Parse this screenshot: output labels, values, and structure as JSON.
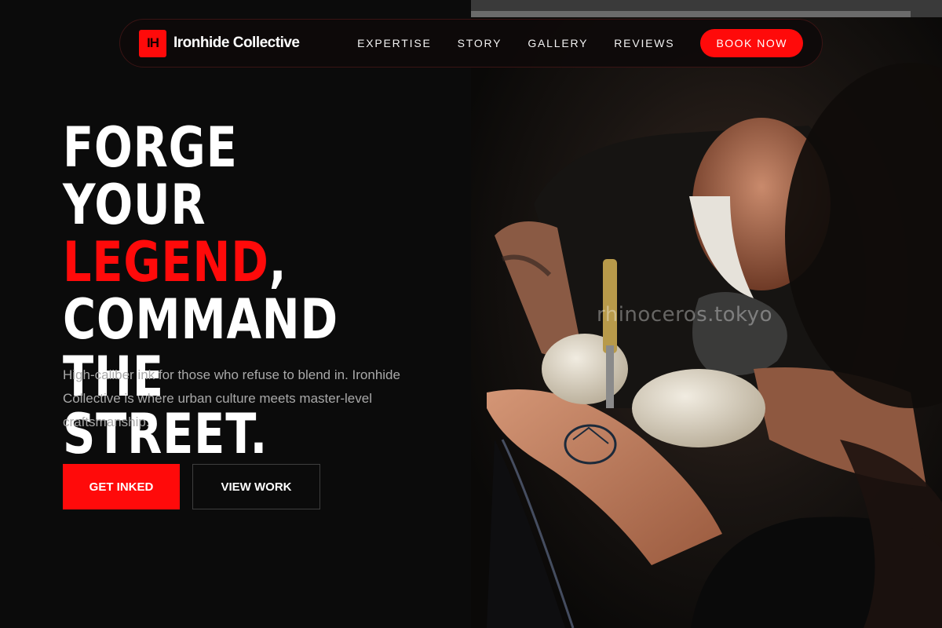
{
  "brand": {
    "mark": "IH",
    "name": "Ironhide Collective"
  },
  "nav": {
    "links": [
      "EXPERTISE",
      "STORY",
      "GALLERY",
      "REVIEWS"
    ],
    "cta": "BOOK NOW"
  },
  "hero": {
    "title_line1": "FORGE YOUR",
    "title_accent": "LEGEND",
    "title_comma": ",",
    "title_line3": "COMMAND THE",
    "title_line4": "STREET.",
    "description": "High-caliber ink for those who refuse to blend in. Ironhide Collective is where urban culture meets master-level craftsmanship.",
    "primary_button": "GET INKED",
    "secondary_button": "VIEW WORK"
  },
  "photo": {
    "watermark": "rhinoceros.tokyo"
  },
  "colors": {
    "accent": "#ff0a0a",
    "background": "#0b0b0b",
    "text_muted": "#a9a9a9"
  }
}
